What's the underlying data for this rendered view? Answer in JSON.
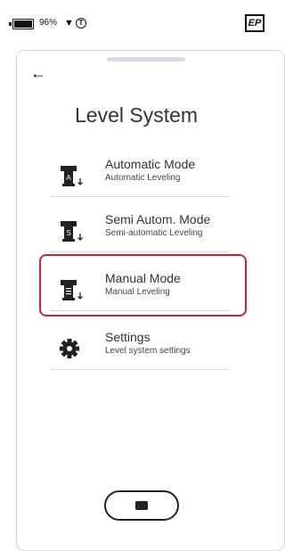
{
  "status": {
    "battery_percent": "96%",
    "brand_logo_text": "EP"
  },
  "header": {
    "title": "Level System"
  },
  "menu": {
    "items": [
      {
        "id": "automatic",
        "label": "Automatic Mode",
        "sublabel": "Automatic Leveling",
        "icon": "leveling-icon-A",
        "badge": "A"
      },
      {
        "id": "semi",
        "label": "Semi Autom. Mode",
        "sublabel": "Semi-automatic Leveling",
        "icon": "leveling-icon-S",
        "badge": "S"
      },
      {
        "id": "manual",
        "label": "Manual Mode",
        "sublabel": "Manual Leveling",
        "icon": "leveling-icon-manual",
        "badge": "≡",
        "highlighted": true
      },
      {
        "id": "settings",
        "label": "Settings",
        "sublabel": "Level system settings",
        "icon": "gear-icon"
      }
    ]
  },
  "colors": {
    "highlight_border": "#c8262c"
  }
}
